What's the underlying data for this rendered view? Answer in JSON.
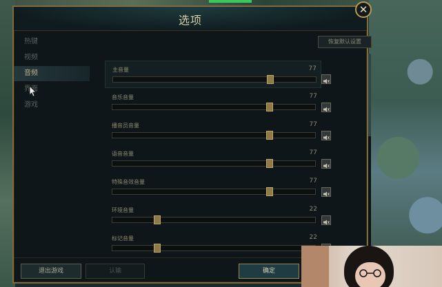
{
  "dialog": {
    "title": "选项",
    "close_symbol": "✕",
    "reset_label": "恢复默认设置"
  },
  "sidebar": {
    "items": [
      {
        "label": "热键",
        "active": false
      },
      {
        "label": "视频",
        "active": false
      },
      {
        "label": "音频",
        "active": true
      },
      {
        "label": "界面",
        "active": false
      },
      {
        "label": "游戏",
        "active": false
      }
    ]
  },
  "sliders": [
    {
      "label": "主音量",
      "value": "77",
      "level": 0.77,
      "highlight": true
    },
    {
      "label": "音乐音量",
      "value": "77",
      "level": 0.77,
      "highlight": false
    },
    {
      "label": "播音员音量",
      "value": "77",
      "level": 0.77,
      "highlight": false
    },
    {
      "label": "语音音量",
      "value": "77",
      "level": 0.77,
      "highlight": false
    },
    {
      "label": "特殊音效音量",
      "value": "77",
      "level": 0.77,
      "highlight": false
    },
    {
      "label": "环境音量",
      "value": "22",
      "level": 0.22,
      "highlight": false
    },
    {
      "label": "标记音量",
      "value": "22",
      "level": 0.22,
      "highlight": false
    }
  ],
  "footer": {
    "exit_label": "退出游戏",
    "surrender_label": "认输",
    "ok_label": "确定"
  },
  "colors": {
    "accent_gold": "#b79c5a",
    "panel_bg": "#0e1619",
    "health_green": "#38c85c"
  },
  "icons": [
    "close-icon",
    "speaker-mute-icon",
    "mouse-pointer-icon"
  ]
}
